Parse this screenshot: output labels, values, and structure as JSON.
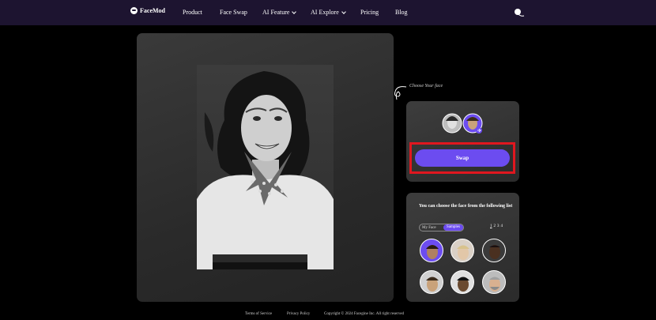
{
  "nav": {
    "brand": "FaceMod",
    "links": [
      "Product",
      "Face Swap",
      "AI Feature",
      "AI Explore",
      "Pricing",
      "Blog"
    ]
  },
  "annotation": {
    "choose_face": "Choose Your face"
  },
  "swap": {
    "button_label": "Swap"
  },
  "faces_panel": {
    "title": "You can choose the face from the following list",
    "tabs": [
      "My Face",
      "Samples"
    ],
    "active_tab": "Samples",
    "pages": [
      "1",
      "2",
      "3",
      "4"
    ],
    "current_page": "1"
  },
  "footer": {
    "terms": "Terms of Service",
    "privacy": "Privacy Policy",
    "copyright": "Copyright © 2024 Facegine Inc. All right reserved"
  },
  "colors": {
    "nav_bg": "#1d1430",
    "accent": "#6c4cf0",
    "highlight_box": "#e0171f",
    "page_bg": "#000000"
  }
}
